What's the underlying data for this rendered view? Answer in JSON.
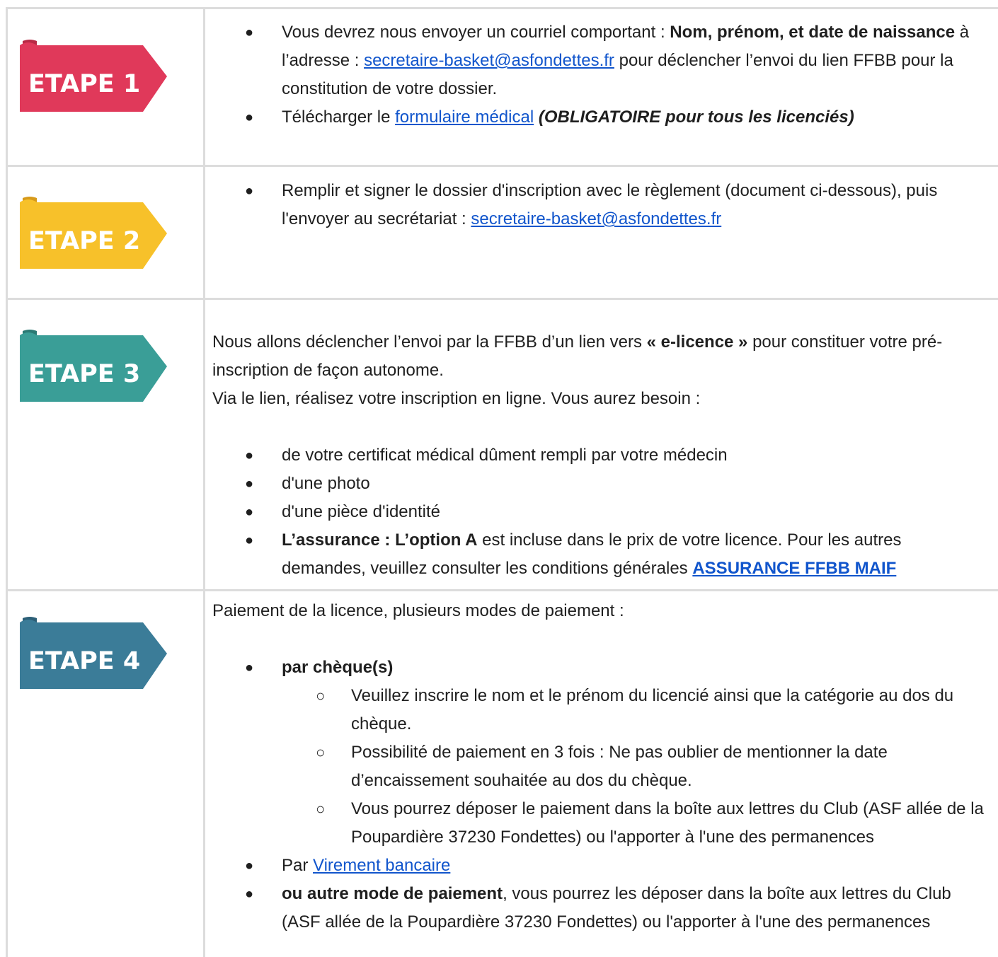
{
  "steps": [
    {
      "label": "ETAPE 1",
      "color": "#e0395a",
      "dark": "#b82a45"
    },
    {
      "label": "ETAPE 2",
      "color": "#f7c12a",
      "dark": "#d79a1a"
    },
    {
      "label": "ETAPE 3",
      "color": "#3a9e97",
      "dark": "#2a7a74"
    },
    {
      "label": "ETAPE 4",
      "color": "#3b7c98",
      "dark": "#2c5f77"
    }
  ],
  "step1": {
    "b1_t1": "Vous devrez nous envoyer un courriel comportant : ",
    "b1_bold": "Nom, prénom, et date de naissance",
    "b1_t2": " à l’adresse : ",
    "b1_link": "secretaire-basket@asfondettes.fr",
    "b1_t3": " pour déclencher l’envoi du lien FFBB pour la constitution de votre dossier.",
    "b2_t1": "Télécharger le ",
    "b2_link": "formulaire médical",
    "b2_em": "(OBLIGATOIRE pour tous les licenciés)"
  },
  "step2": {
    "t1": "Remplir et signer le dossier d'inscription avec le règlement (document ci-dessous), puis l'envoyer au secrétariat : ",
    "link": "secretaire-basket@asfondettes.fr"
  },
  "step3": {
    "p1_t1": "Nous allons déclencher l’envoi par la FFBB d’un lien vers ",
    "p1_bold": "« e-licence »",
    "p1_t2": " pour constituer votre pré-inscription de façon autonome.",
    "p2": "Via le lien, réalisez votre inscription en ligne. Vous aurez besoin  :",
    "items": [
      "de votre certificat médical dûment rempli par votre médecin",
      "d'une photo",
      "d'une pièce d'identité"
    ],
    "ins_bold": "L’assurance : L’option A",
    "ins_t": " est incluse dans le prix de votre licence. Pour les autres demandes, veuillez consulter les conditions générales ",
    "ins_link": "ASSURANCE FFBB MAIF"
  },
  "step4": {
    "intro": "Paiement de la licence, plusieurs modes de paiement :",
    "cheque": "par chèque(s)",
    "sub": [
      "Veuillez inscrire le nom et le prénom du licencié ainsi que la catégorie au dos du chèque.",
      "Possibilité de paiement en 3 fois : Ne pas oublier de mentionner la date d’encaissement souhaitée au dos du chèque.",
      "Vous pourrez déposer le paiement dans la boîte aux lettres du Club (ASF allée de la Poupardière 37230 Fondettes) ou l'apporter à l'une des permanences"
    ],
    "par": "Par ",
    "vir_link": "Virement bancaire",
    "autre_bold": "ou autre mode de paiement",
    "autre_t": ", vous pourrez les déposer dans la boîte aux lettres du Club (ASF allée de la Poupardière 37230 Fondettes) ou l'apporter à l'une des permanences"
  }
}
